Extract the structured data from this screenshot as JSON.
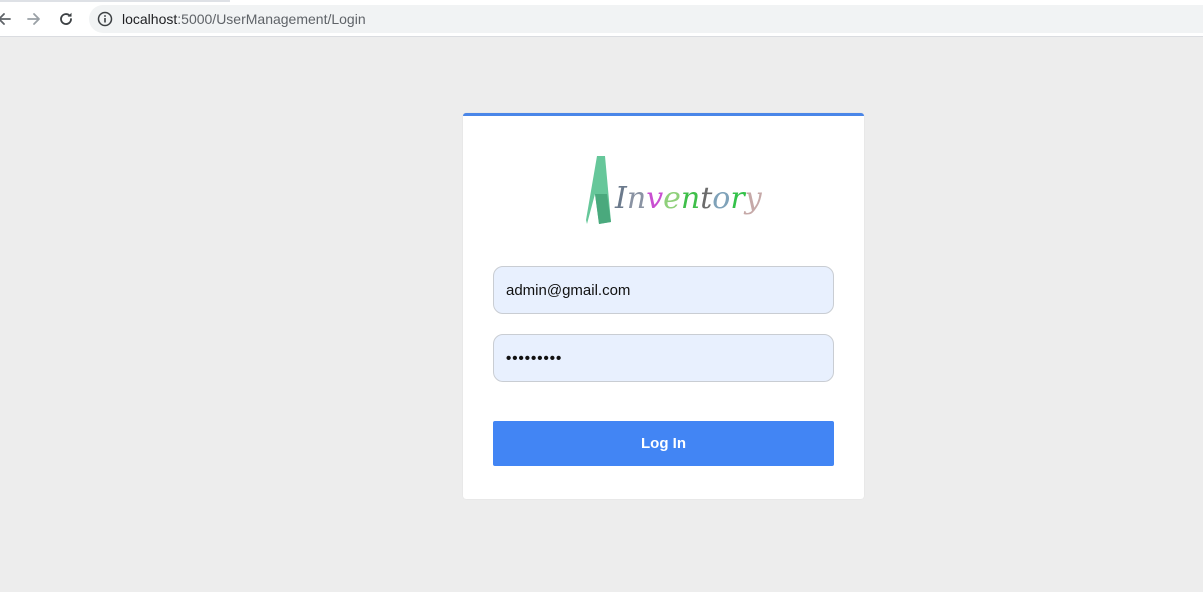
{
  "browser": {
    "back_icon": "arrow-left-icon",
    "forward_icon": "arrow-right-icon",
    "reload_icon": "reload-icon",
    "info_icon": "info-icon",
    "url_host": "localhost",
    "url_path": ":5000/UserManagement/Login"
  },
  "login": {
    "logo_text": {
      "first": "A",
      "rest": [
        {
          "ch": "I",
          "color": "#6b7a8c"
        },
        {
          "ch": "n",
          "color": "#8a93a3"
        },
        {
          "ch": "v",
          "color": "#c94fd1"
        },
        {
          "ch": "e",
          "color": "#8fd07a"
        },
        {
          "ch": "n",
          "color": "#3fbf4a"
        },
        {
          "ch": "t",
          "color": "#6b6b6b"
        },
        {
          "ch": "o",
          "color": "#7fa2b9"
        },
        {
          "ch": "r",
          "color": "#34c24a"
        },
        {
          "ch": "y",
          "color": "#c6a9a8"
        }
      ]
    },
    "email_value": "admin@gmail.com",
    "password_value": "•••••••••",
    "submit_label": "Log In"
  },
  "colors": {
    "accent": "#4285f4",
    "card_top_border": "#4a86e8",
    "page_background": "#ededed",
    "field_background": "#e8f0fe"
  }
}
